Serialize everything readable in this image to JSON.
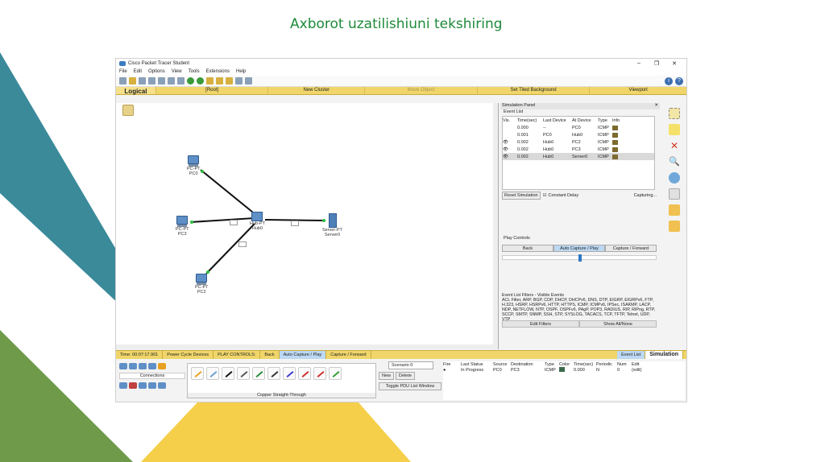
{
  "slide": {
    "title": "Axborot uzatilishiuni tekshiring"
  },
  "colors": {
    "teal": "#3a8a9a",
    "green": "#6f9a4a",
    "yellow": "#f5cf4a",
    "title_green": "#1f8a3a",
    "nav_yellow": "#f0d66a"
  },
  "window": {
    "title": "Cisco Packet Tracer Student",
    "controls": {
      "min": "–",
      "max": "❐",
      "close": "✕"
    },
    "menu": [
      "File",
      "Edit",
      "Options",
      "View",
      "Tools",
      "Extensions",
      "Help"
    ]
  },
  "navbar": {
    "logical": "Logical",
    "root": "[Root]",
    "new_cluster": "New Cluster",
    "move_object": "Move Object",
    "tiled_bg": "Set Tiled Background",
    "viewport": "Viewport"
  },
  "devices": {
    "pc0": {
      "type": "PC-PT",
      "name": "PC0"
    },
    "pc3": {
      "type": "PC-PT",
      "name": "PC3"
    },
    "pc2": {
      "type": "PC-PT",
      "name": "PC2"
    },
    "hub": {
      "type": "Hub-PT",
      "name": "Hub0"
    },
    "server": {
      "type": "Server-PT",
      "name": "Server0"
    }
  },
  "sim_panel": {
    "title": "Simulation Panel",
    "event_list_label": "Event List",
    "columns": [
      "Vis.",
      "Time(sec)",
      "Last Device",
      "At Device",
      "Type",
      "Info"
    ],
    "events": [
      {
        "vis": "",
        "time": "0.000",
        "last": "--",
        "at": "PC0",
        "type": "ICMP"
      },
      {
        "vis": "",
        "time": "0.001",
        "last": "PC0",
        "at": "Hub0",
        "type": "ICMP"
      },
      {
        "vis": "👁",
        "time": "0.002",
        "last": "Hub0",
        "at": "PC2",
        "type": "ICMP"
      },
      {
        "vis": "👁",
        "time": "0.002",
        "last": "Hub0",
        "at": "PC3",
        "type": "ICMP"
      },
      {
        "vis": "👁",
        "time": "0.002",
        "last": "Hub0",
        "at": "Server0",
        "type": "ICMP"
      }
    ],
    "reset": "Reset Simulation",
    "constant_delay": "Constant Delay",
    "capturing": "Capturing...",
    "play_controls": "Play Controls",
    "back": "Back",
    "auto_capture": "Auto Capture / Play",
    "capture_forward": "Capture / Forward",
    "filters_title": "Event List Filters - Visible Events",
    "filters_text": "ACL Filter, ARP, BGP, CDP, DHCP, DHCPv6, DNS, DTP, EIGRP, EIGRPv6, FTP, H.323, HSRP, HSRPv6, HTTP, HTTPS, ICMP, ICMPv6, IPSec, ISAKMP, LACP, NDP, NETFLOW, NTP, OSPF, OSPFv6, PAgP, POP3, RADIUS, RIP, RIPng, RTP, SCCP, SMTP, SNMP, SSH, STP, SYSLOG, TACACS, TCP, TFTP, Telnet, UDP, VTP",
    "edit_filters": "Edit Filters",
    "show_all": "Show All/None"
  },
  "statusbar": {
    "time": "Time: 00:07:17.901",
    "power_cycle": "Power Cycle Devices",
    "play_controls": "PLAY CONTROLS:",
    "back": "Back",
    "auto": "Auto Capture / Play",
    "forward": "Capture / Forward",
    "event_list": "Event List",
    "simulation": "Simulation"
  },
  "bottom": {
    "connections": "Connections",
    "cable_name": "Copper Straight-Through",
    "scenario": "Scenario 0",
    "new": "New",
    "delete": "Delete",
    "toggle": "Toggle PDU List Window",
    "pdu_columns": [
      "Fire",
      "Last Status",
      "Source",
      "Destination",
      "Type",
      "Color",
      "Time(sec)",
      "Periodic",
      "Num",
      "Edit"
    ],
    "pdu_row": {
      "fire": "●",
      "status": "In Progress",
      "source": "PC0",
      "dest": "PC3",
      "type": "ICMP",
      "time": "0.000",
      "periodic": "N",
      "num": "0",
      "edit": "(edit)"
    }
  }
}
